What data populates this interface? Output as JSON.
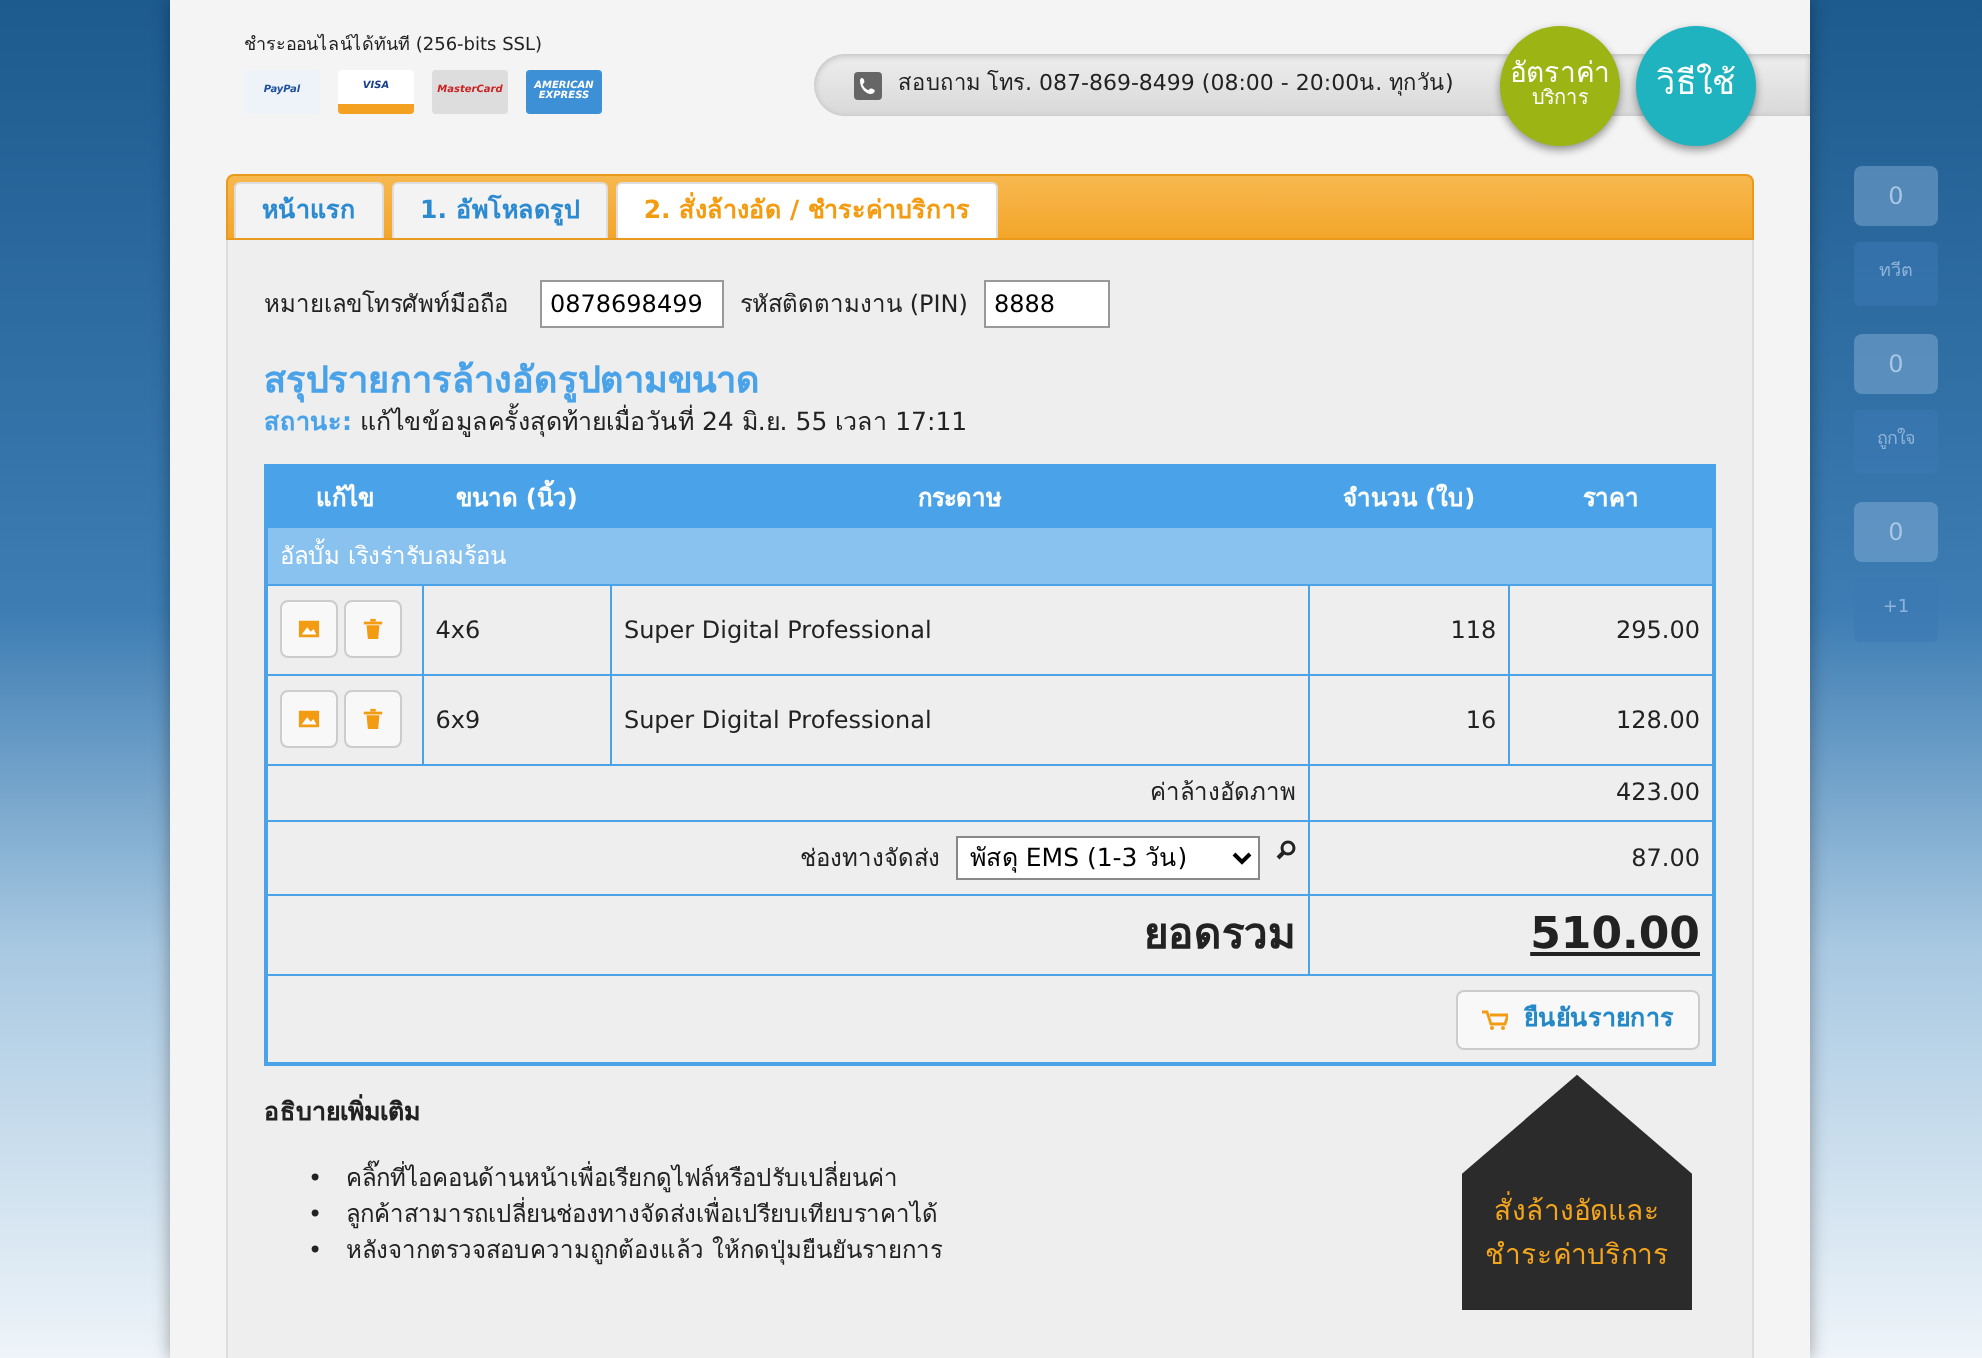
{
  "header": {
    "payment_note": "ชำระออนไลน์ได้ทันที (256-bits SSL)",
    "card_logos": [
      {
        "label": "PayPal"
      },
      {
        "label": "VISA"
      },
      {
        "label": "MasterCard"
      },
      {
        "label": "AMERICAN EXPRESS"
      }
    ],
    "contact": "สอบถาม โทร. 087-869-8499 (08:00 - 20:00น. ทุกวัน)",
    "tags": [
      {
        "title": "อัตราค่า",
        "subtitle": "บริการ",
        "color": "#9cb514"
      },
      {
        "title": "วิธีใช้",
        "color": "#1fb3bf"
      }
    ]
  },
  "tabs": [
    {
      "label": "หน้าแรก",
      "selected": false
    },
    {
      "label": "1. อัพโหลดรูป",
      "selected": false
    },
    {
      "label": "2. สั่งล้างอัด / ชำระค่าบริการ",
      "selected": true
    }
  ],
  "form": {
    "phone_label": "หมายเลขโทรศัพท์มือถือ",
    "phone_value": "0878698499",
    "pin_label": "รหัสติดตามงาน (PIN)",
    "pin_value": "8888"
  },
  "summary": {
    "title": "สรุปรายการล้างอัดรูปตามขนาด",
    "status_label": "สถานะ:",
    "status_text": "แก้ไขข้อมูลครั้งสุดท้ายเมื่อวันที่ 24 มิ.ย. 55 เวลา 17:11"
  },
  "table": {
    "columns": [
      "แก้ไข",
      "ขนาด (นิ้ว)",
      "กระดาษ",
      "จำนวน (ใบ)",
      "ราคา"
    ],
    "group": "อัลบั้ม เริงร่ารับลมร้อน",
    "rows": [
      {
        "size": "4x6",
        "paper": "Super Digital Professional",
        "quantity": "118",
        "price": "295.00"
      },
      {
        "size": "6x9",
        "paper": "Super Digital Professional",
        "quantity": "16",
        "price": "128.00"
      }
    ],
    "subtotal_label": "ค่าล้างอัดภาพ",
    "subtotal": "423.00",
    "shipping_label": "ช่องทางจัดส่ง",
    "shipping_option": "พัสดุ EMS (1-3 วัน)",
    "shipping": "87.00",
    "total_label": "ยอดรวม",
    "total": "510.00",
    "confirm_button": "ยืนยันรายการ"
  },
  "notes": {
    "title": "อธิบายเพิ่มเติม",
    "bullet": "•",
    "items": [
      "คลิ๊กที่ไอคอนด้านหน้าเพื่อเรียกดูไฟล์หรือปรับเปลี่ยนค่า",
      "ลูกค้าสามารถเปลี่ยนช่องทางจัดส่งเพื่อเปรียบเทียบราคาได้",
      "หลังจากตรวจสอบความถูกต้องแล้ว ให้กดปุ่มยืนยันรายการ"
    ]
  },
  "badge": {
    "lines": [
      "สั่งล้างอัดและ",
      "ชำระค่าบริการ"
    ]
  },
  "social": [
    {
      "count": "0",
      "label": "ทวีต"
    },
    {
      "count": "0",
      "label": "ถูกใจ"
    },
    {
      "count": "0",
      "label": "+1"
    }
  ]
}
